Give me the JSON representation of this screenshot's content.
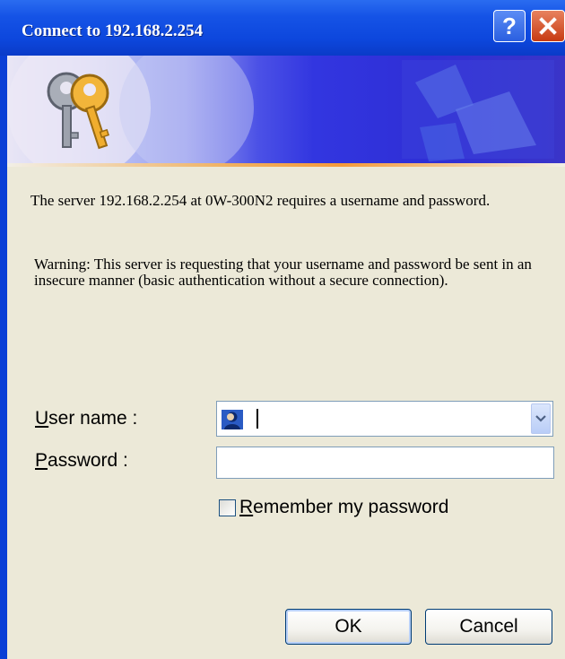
{
  "window": {
    "title": "Connect to 192.168.2.254",
    "help_glyph": "?",
    "close_glyph": "X"
  },
  "banner": {
    "icon": "keys-icon"
  },
  "message": "The server 192.168.2.254 at 0W-300N2 requires a username and password.",
  "warning": "Warning: This server is requesting that your username and password be sent in an insecure manner (basic authentication without a secure connection).",
  "form": {
    "username_label_accel": "U",
    "username_label_rest": "ser name :",
    "username_value": "",
    "password_label_accel": "P",
    "password_label_rest": "assword :",
    "password_value": "",
    "remember_accel": "R",
    "remember_rest": "emember my password",
    "remember_checked": false
  },
  "buttons": {
    "ok": "OK",
    "cancel": "Cancel"
  }
}
